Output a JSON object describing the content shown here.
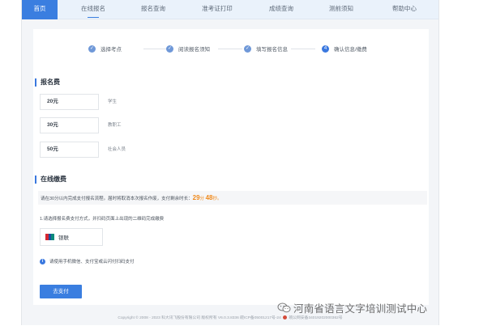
{
  "nav": {
    "items": [
      {
        "label": "首页"
      },
      {
        "label": "在线报名"
      },
      {
        "label": "报名查询"
      },
      {
        "label": "准考证打印"
      },
      {
        "label": "成绩查询"
      },
      {
        "label": "测前须知"
      },
      {
        "label": "帮助中心"
      }
    ],
    "active_index": 0,
    "current_index": 1
  },
  "steps": [
    {
      "label": "选择考点",
      "marker": "✓"
    },
    {
      "label": "阅读报名须知",
      "marker": "✓"
    },
    {
      "label": "填写报名信息",
      "marker": "✓"
    },
    {
      "label": "确认信息/缴费",
      "marker": "4"
    }
  ],
  "fees": {
    "title": "报名费",
    "items": [
      {
        "amount": "20元",
        "who": "学生"
      },
      {
        "amount": "30元",
        "who": "教职工"
      },
      {
        "amount": "50元",
        "who": "社会人员"
      }
    ]
  },
  "payment": {
    "title": "在线缴费",
    "timer_text_before": "请在30分以内完成支付报名流程。届时将取消本次报名作废，支付剩余时长：",
    "minutes": "29",
    "min_unit": "分",
    "seconds": "48",
    "sec_unit": "秒。",
    "hint": "1.请选择报名费支付方式，并扫码页面上出现的二维码完成缴费",
    "method_label": "银联",
    "method_icon": "unionpay-logo",
    "notice_icon": "info-icon",
    "notice": "请使用手机微信、支付宝或云闪付扫码支付",
    "button_label": "去支付"
  },
  "footer": {
    "text_before": "Copyright © 2008 - 2023 科大讯飞股份有限公司 版权所有 V6.0.3.8336  皖ICP备05001217号-24",
    "text_after": "皖公网安备34019202000362号"
  },
  "watermark": {
    "text": "河南省语言文字培训测试中心",
    "icon": "wechat-icon"
  },
  "colors": {
    "accent": "#3a7ee0",
    "timer": "#f08a1c",
    "nav_bg": "#eaf2fb"
  }
}
